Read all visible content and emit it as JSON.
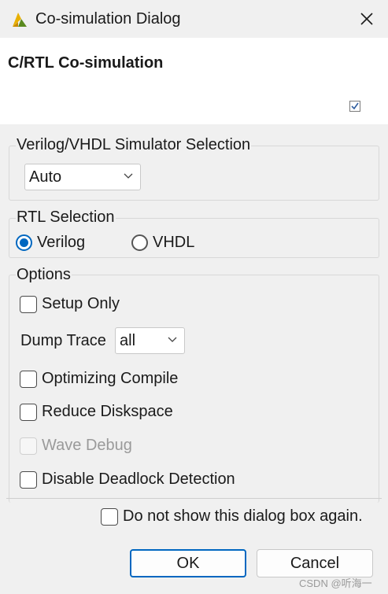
{
  "window": {
    "title": "Co-simulation Dialog",
    "app_icon": "vivado-hls-icon",
    "close_icon": "close-icon"
  },
  "header": {
    "title": "C/RTL Co-simulation",
    "checked": true
  },
  "simulator_group": {
    "legend": "Verilog/VHDL Simulator Selection",
    "selected": "Auto"
  },
  "rtl_group": {
    "legend": "RTL Selection",
    "options": [
      {
        "label": "Verilog",
        "selected": true
      },
      {
        "label": "VHDL",
        "selected": false
      }
    ]
  },
  "options_group": {
    "legend": "Options",
    "setup_only": {
      "label": "Setup Only",
      "checked": false
    },
    "dump_trace": {
      "label": "Dump Trace",
      "value": "all"
    },
    "optimizing_compile": {
      "label": "Optimizing Compile",
      "checked": false
    },
    "reduce_diskspace": {
      "label": "Reduce Diskspace",
      "checked": false
    },
    "wave_debug": {
      "label": "Wave Debug",
      "checked": false,
      "enabled": false
    },
    "disable_deadlock": {
      "label": "Disable Deadlock Detection",
      "checked": false
    }
  },
  "footer": {
    "do_not_show": {
      "label": "Do not show this dialog box again.",
      "checked": false
    },
    "ok_label": "OK",
    "cancel_label": "Cancel"
  },
  "watermark": "CSDN @听海一",
  "colors": {
    "accent": "#0067c0",
    "dialog_bg": "#f0f0f0",
    "header_bg": "#ffffff"
  }
}
